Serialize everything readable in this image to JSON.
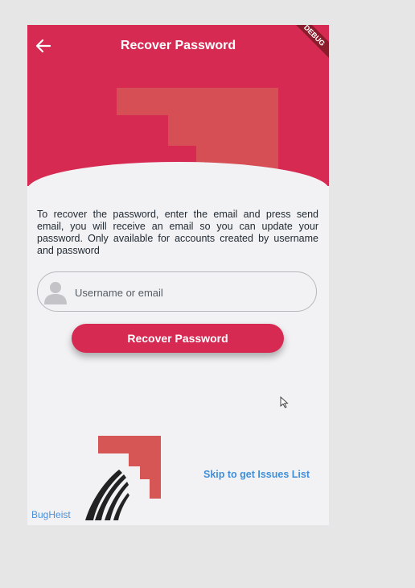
{
  "appbar": {
    "title": "Recover Password",
    "back_icon": "arrow-left-icon",
    "debug_banner": "DEBUG"
  },
  "content": {
    "description": "To recover the password, enter the email and press send email, you will receive an email so you can update your password. Only available for accounts created by username and password"
  },
  "form": {
    "username_placeholder": "Username or email",
    "username_value": "",
    "user_icon": "user-icon",
    "submit_label": "Recover Password"
  },
  "footer": {
    "skip_link": "Skip to get Issues List",
    "brand": "BugHeist"
  },
  "colors": {
    "primary": "#d72a52",
    "link": "#3f8fd9",
    "background": "#f2f2f4"
  }
}
